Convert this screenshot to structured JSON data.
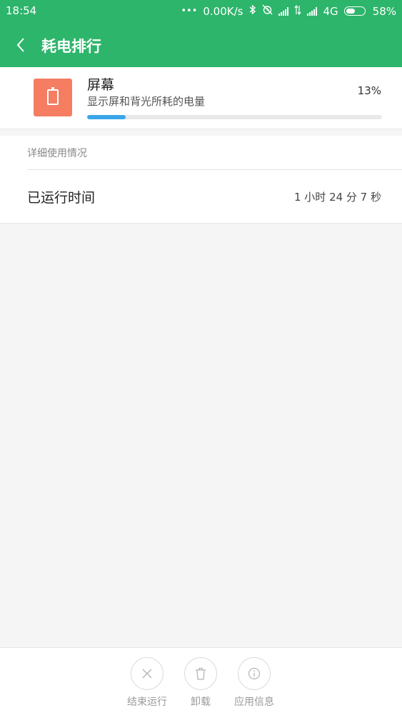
{
  "status_bar": {
    "time": "18:54",
    "network_speed": "0.00K/s",
    "network_type": "4G",
    "battery": "58%",
    "battery_level": 0.58,
    "icons": [
      "more-dots-icon",
      "bluetooth-icon",
      "alarm-off-icon",
      "signal-icon",
      "data-arrows-icon",
      "signal-icon",
      "battery-icon"
    ]
  },
  "header": {
    "title": "耗电排行",
    "back_icon": "chevron-left-icon"
  },
  "item": {
    "name": "屏幕",
    "description": "显示屏和背光所耗的电量",
    "percent": "13%",
    "usage_fraction": 0.13,
    "icon": "tablet-icon",
    "icon_color": "#f47d62"
  },
  "details": {
    "section_title": "详细使用情况",
    "runtime_label": "已运行时间",
    "runtime_value": "1 小时 24 分 7 秒"
  },
  "actions": [
    {
      "label": "结束运行",
      "icon": "close-icon"
    },
    {
      "label": "卸载",
      "icon": "trash-icon"
    },
    {
      "label": "应用信息",
      "icon": "info-icon"
    }
  ],
  "colors": {
    "accent": "#2db56b",
    "progress": "#3aa6e8"
  }
}
